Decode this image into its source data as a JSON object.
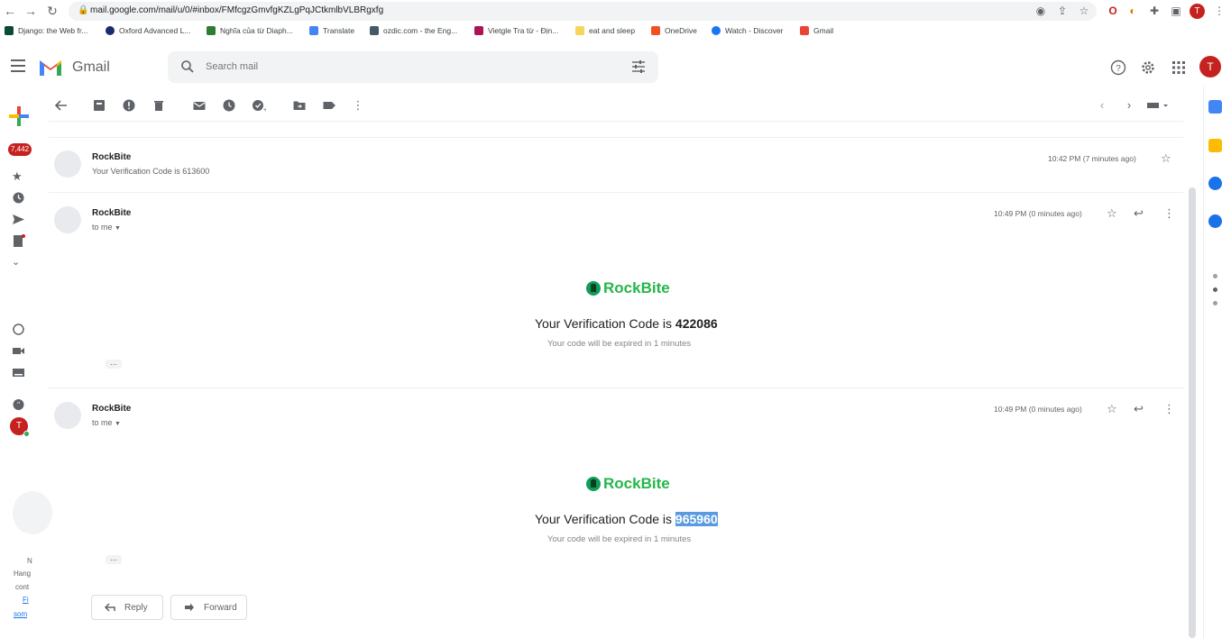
{
  "browser": {
    "url": "mail.google.com/mail/u/0/#inbox/FMfcgzGmvfgKZLgPqJCtkmlbVLBRgxfg",
    "profile_initial": "T",
    "bookmarks": [
      "Django: the Web fr...",
      "Oxford Advanced L...",
      "Nghĩa của từ Diaph...",
      "Translate",
      "ozdic.com - the Eng...",
      "Vietgle Tra từ - Địn...",
      "eat and sleep",
      "OneDrive",
      "Watch - Discover",
      "Gmail"
    ]
  },
  "header": {
    "app_name": "Gmail",
    "search_placeholder": "Search mail",
    "account_initial": "T"
  },
  "rail": {
    "inbox_count": "7,442",
    "account_initial": "T",
    "partial_text": [
      "N",
      "Hang",
      "cont",
      "Fi",
      "som"
    ]
  },
  "messages": [
    {
      "sender": "RockBite",
      "snippet": "Your Verification Code is 613600",
      "time": "10:42 PM (7 minutes ago)",
      "collapsed": true
    },
    {
      "sender": "RockBite",
      "recipient": "to me",
      "time": "10:49 PM (0 minutes ago)",
      "brand": "RockBite",
      "code_prefix": "Your Verification Code is",
      "code": "422086",
      "expiry": "Your code will be expired in 1 minutes"
    },
    {
      "sender": "RockBite",
      "recipient": "to me",
      "time": "10:49 PM (0 minutes ago)",
      "brand": "RockBite",
      "code_prefix": "Your Verification Code is",
      "code": "965960",
      "expiry": "Your code will be expired in 1 minutes",
      "code_selected": true
    }
  ],
  "actions": {
    "reply": "Reply",
    "forward": "Forward"
  },
  "colors": {
    "gmail_red": "#c5221f",
    "brand_green": "#24b64a",
    "selection_blue": "#5a9be0"
  }
}
